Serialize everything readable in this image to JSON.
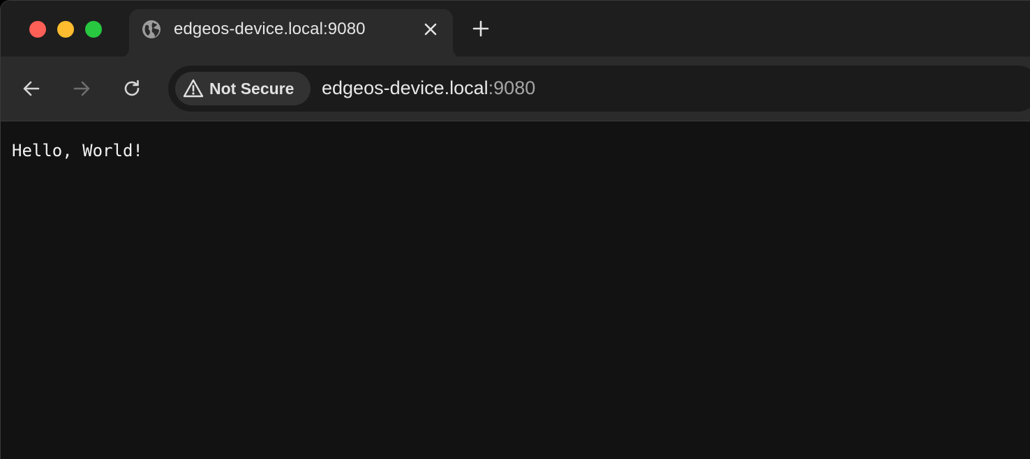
{
  "window": {
    "traffic_lights": [
      {
        "name": "close",
        "color": "#fe5f57"
      },
      {
        "name": "minimize",
        "color": "#febc2e"
      },
      {
        "name": "zoom",
        "color": "#28c840"
      }
    ]
  },
  "tabs": [
    {
      "title": "edgeos-device.local:9080",
      "favicon": "globe-icon",
      "active": true
    }
  ],
  "toolbar": {
    "back_icon": "arrow-left-icon",
    "forward_icon": "arrow-right-icon",
    "forward_enabled": false,
    "reload_icon": "reload-icon"
  },
  "omnibox": {
    "security_icon": "warning-triangle-icon",
    "security_label": "Not Secure",
    "url_host": "edgeos-device.local",
    "url_port": ":9080"
  },
  "page": {
    "text": "Hello, World!"
  },
  "colors": {
    "tabstrip": "#1e1e1e",
    "toolbar": "#2b2b2b",
    "page_background": "#121212"
  }
}
